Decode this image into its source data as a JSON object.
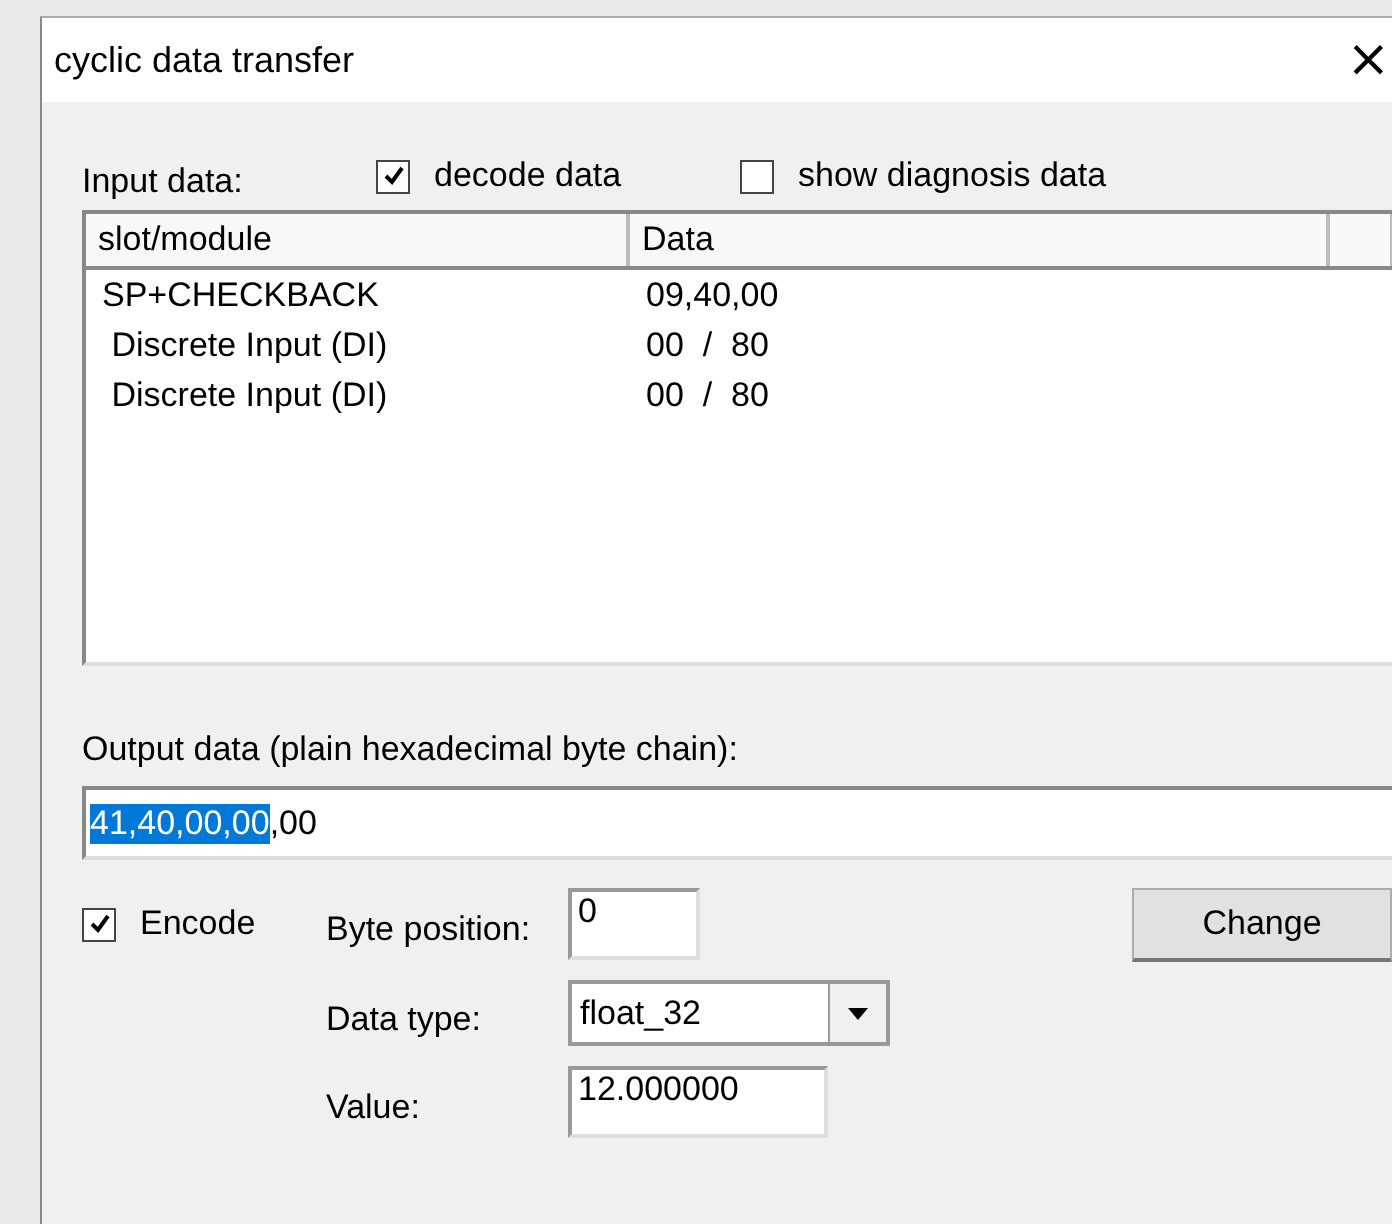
{
  "window": {
    "title": "cyclic data transfer",
    "close": "×"
  },
  "input": {
    "label": "Input data:",
    "options": [
      {
        "label": "decode data",
        "checked": true
      },
      {
        "label": "show diagnosis data",
        "checked": false
      }
    ],
    "columns": [
      "slot/module",
      "Data"
    ],
    "rows": [
      {
        "module": "SP+CHECKBACK",
        "data": "09,40,00"
      },
      {
        "module": " Discrete Input (DI)",
        "data": "00  /  80"
      },
      {
        "module": " Discrete Input (DI)",
        "data": "00  /  80"
      }
    ]
  },
  "output": {
    "label": "Output data (plain hexadecimal byte chain):",
    "value_selected": "41,40,00,00",
    "value_rest": ",00"
  },
  "encode": {
    "label": "Encode",
    "checked": true,
    "byte_position": {
      "label": "Byte position:",
      "value": "0"
    },
    "data_type": {
      "label": "Data type:",
      "value": "float_32"
    },
    "value": {
      "label": "Value:",
      "value": "12.000000"
    },
    "button": "Change"
  }
}
